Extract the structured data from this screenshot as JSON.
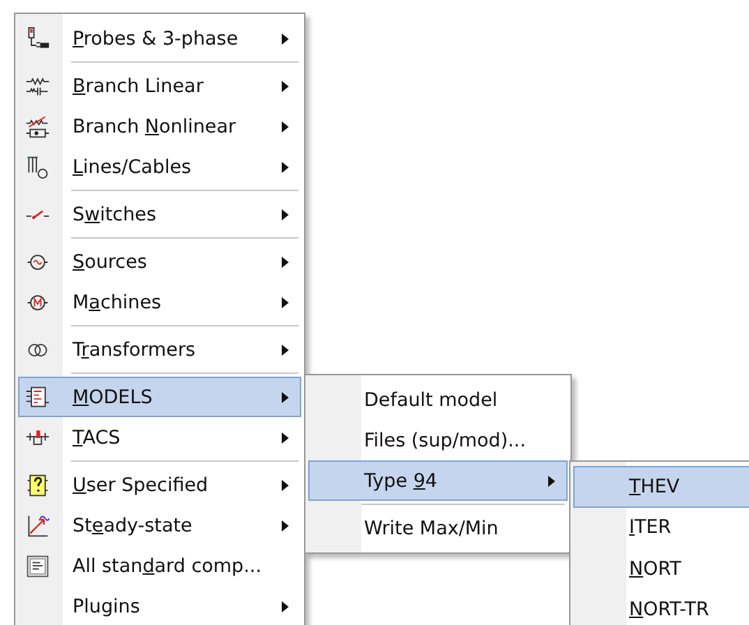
{
  "main_menu": {
    "items": [
      {
        "kind": "item",
        "label_parts": [
          {
            "text": "P",
            "underlined": true
          },
          {
            "text": "robes & 3-phase",
            "underlined": false
          }
        ],
        "has_submenu": true,
        "selected": false
      },
      {
        "kind": "separator"
      },
      {
        "kind": "item",
        "label_parts": [
          {
            "text": "B",
            "underlined": true
          },
          {
            "text": "ranch Linear",
            "underlined": false
          }
        ],
        "has_submenu": true,
        "selected": false
      },
      {
        "kind": "item",
        "label_parts": [
          {
            "text": "Branch ",
            "underlined": false
          },
          {
            "text": "N",
            "underlined": true
          },
          {
            "text": "onlinear",
            "underlined": false
          }
        ],
        "has_submenu": true,
        "selected": false
      },
      {
        "kind": "item",
        "label_parts": [
          {
            "text": "L",
            "underlined": true
          },
          {
            "text": "ines/Cables",
            "underlined": false
          }
        ],
        "has_submenu": true,
        "selected": false
      },
      {
        "kind": "separator"
      },
      {
        "kind": "item",
        "label_parts": [
          {
            "text": "S",
            "underlined": false
          },
          {
            "text": "w",
            "underlined": true
          },
          {
            "text": "itches",
            "underlined": false
          }
        ],
        "has_submenu": true,
        "selected": false
      },
      {
        "kind": "separator"
      },
      {
        "kind": "item",
        "label_parts": [
          {
            "text": "S",
            "underlined": true
          },
          {
            "text": "ources",
            "underlined": false
          }
        ],
        "has_submenu": true,
        "selected": false
      },
      {
        "kind": "item",
        "label_parts": [
          {
            "text": "M",
            "underlined": false
          },
          {
            "text": "a",
            "underlined": true
          },
          {
            "text": "chines",
            "underlined": false
          }
        ],
        "has_submenu": true,
        "selected": false
      },
      {
        "kind": "separator"
      },
      {
        "kind": "item",
        "label_parts": [
          {
            "text": "T",
            "underlined": false
          },
          {
            "text": "r",
            "underlined": true
          },
          {
            "text": "ansformers",
            "underlined": false
          }
        ],
        "has_submenu": true,
        "selected": false
      },
      {
        "kind": "separator"
      },
      {
        "kind": "item",
        "label_parts": [
          {
            "text": "M",
            "underlined": true
          },
          {
            "text": "ODELS",
            "underlined": false
          }
        ],
        "has_submenu": true,
        "selected": true
      },
      {
        "kind": "item",
        "label_parts": [
          {
            "text": "T",
            "underlined": true
          },
          {
            "text": "ACS",
            "underlined": false
          }
        ],
        "has_submenu": true,
        "selected": false
      },
      {
        "kind": "separator"
      },
      {
        "kind": "item",
        "label_parts": [
          {
            "text": "U",
            "underlined": true
          },
          {
            "text": "ser Specified",
            "underlined": false
          }
        ],
        "has_submenu": true,
        "selected": false
      },
      {
        "kind": "item",
        "label_parts": [
          {
            "text": "St",
            "underlined": false
          },
          {
            "text": "e",
            "underlined": true
          },
          {
            "text": "ady-state",
            "underlined": false
          }
        ],
        "has_submenu": true,
        "selected": false
      },
      {
        "kind": "item",
        "label_parts": [
          {
            "text": "All stan",
            "underlined": false
          },
          {
            "text": "d",
            "underlined": true
          },
          {
            "text": "ard comp...",
            "underlined": false
          }
        ],
        "has_submenu": false,
        "selected": false
      },
      {
        "kind": "item",
        "label_parts": [
          {
            "text": "Plugins",
            "underlined": false
          }
        ],
        "has_submenu": true,
        "selected": false
      }
    ]
  },
  "models_submenu": {
    "items": [
      {
        "kind": "item",
        "label_parts": [
          {
            "text": "Default model",
            "underlined": false
          }
        ],
        "has_submenu": false,
        "selected": false
      },
      {
        "kind": "item",
        "label_parts": [
          {
            "text": "Files (sup/mod)...",
            "underlined": false
          }
        ],
        "has_submenu": false,
        "selected": false
      },
      {
        "kind": "item",
        "label_parts": [
          {
            "text": "Type ",
            "underlined": false
          },
          {
            "text": "9",
            "underlined": true
          },
          {
            "text": "4",
            "underlined": false
          }
        ],
        "has_submenu": true,
        "selected": true
      },
      {
        "kind": "separator"
      },
      {
        "kind": "item",
        "label_parts": [
          {
            "text": "Write Max/Min",
            "underlined": false
          }
        ],
        "has_submenu": false,
        "selected": false
      }
    ]
  },
  "type94_submenu": {
    "items": [
      {
        "kind": "item",
        "label_parts": [
          {
            "text": "T",
            "underlined": true
          },
          {
            "text": "HEV",
            "underlined": false
          }
        ],
        "has_submenu": false,
        "selected": true
      },
      {
        "kind": "item",
        "label_parts": [
          {
            "text": "I",
            "underlined": true
          },
          {
            "text": "TER",
            "underlined": false
          }
        ],
        "has_submenu": false,
        "selected": false
      },
      {
        "kind": "item",
        "label_parts": [
          {
            "text": "N",
            "underlined": true
          },
          {
            "text": "ORT",
            "underlined": false
          }
        ],
        "has_submenu": false,
        "selected": false
      },
      {
        "kind": "item",
        "label_parts": [
          {
            "text": "N",
            "underlined": true
          },
          {
            "text": "ORT-TR",
            "underlined": false
          }
        ],
        "has_submenu": false,
        "selected": false
      }
    ]
  }
}
